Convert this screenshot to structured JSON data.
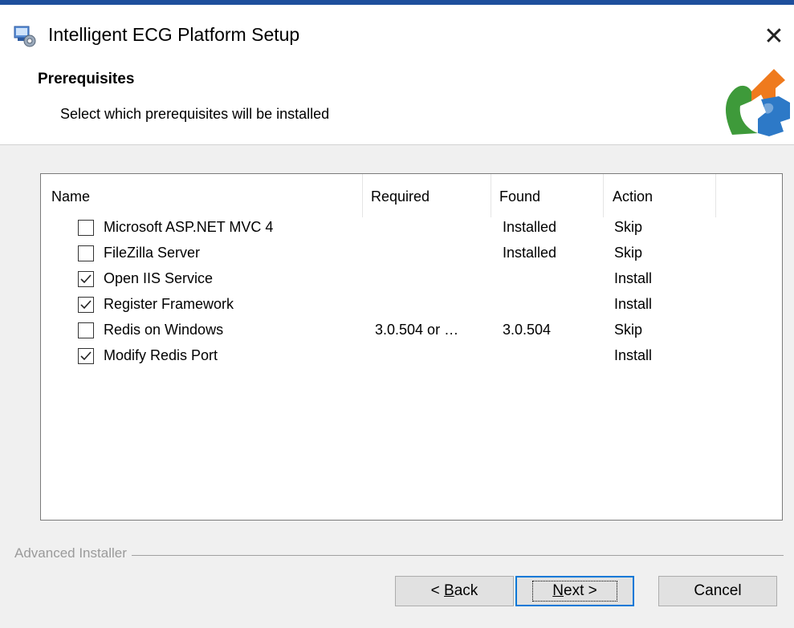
{
  "window": {
    "title": "Intelligent ECG Platform Setup",
    "close_label": "✕"
  },
  "header": {
    "title": "Prerequisites",
    "subtitle": "Select which prerequisites will be installed"
  },
  "table": {
    "columns": [
      "Name",
      "Required",
      "Found",
      "Action"
    ],
    "rows": [
      {
        "name": "Microsoft ASP.NET MVC 4",
        "required": "",
        "found": "Installed",
        "action": "Skip",
        "checked": false
      },
      {
        "name": "FileZilla Server",
        "required": "",
        "found": "Installed",
        "action": "Skip",
        "checked": false
      },
      {
        "name": "Open IIS Service",
        "required": "",
        "found": "",
        "action": "Install",
        "checked": true
      },
      {
        "name": "Register Framework",
        "required": "",
        "found": "",
        "action": "Install",
        "checked": true
      },
      {
        "name": "Redis on Windows",
        "required": "3.0.504 or …",
        "found": "3.0.504",
        "action": "Skip",
        "checked": false
      },
      {
        "name": "Modify Redis Port",
        "required": "",
        "found": "",
        "action": "Install",
        "checked": true
      }
    ]
  },
  "footer": {
    "brand": "Advanced Installer",
    "back_prefix": "< ",
    "back_key": "B",
    "back_rest": "ack",
    "next_key": "N",
    "next_rest": "ext >",
    "cancel_label": "Cancel"
  },
  "icons": {
    "app": "setup-app-icon",
    "header": "puzzle-logo-icon",
    "check": "checkmark-icon"
  },
  "colors": {
    "accent": "#0078d7",
    "title_border": "#1e4f9c"
  }
}
